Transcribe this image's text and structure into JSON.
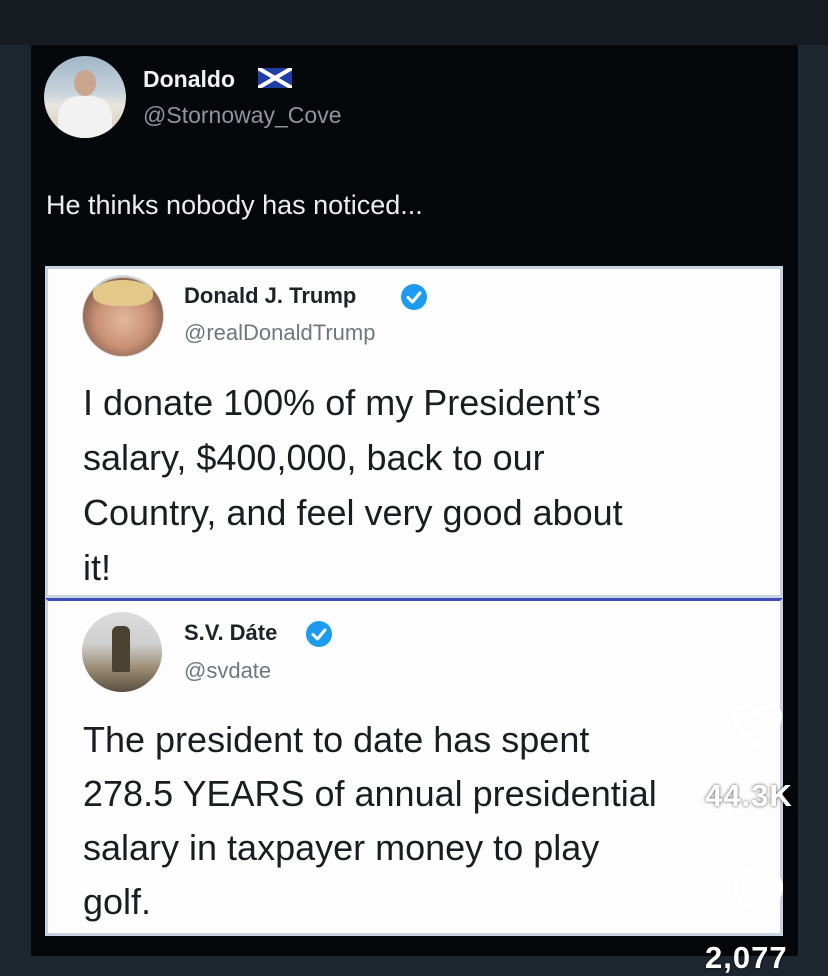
{
  "post": {
    "author_name": "Donaldo",
    "author_flag_icon": "scotland-flag-icon",
    "author_handle": "@Stornoway_Cove",
    "text": "He thinks nobody has noticed..."
  },
  "embedded_tweets": [
    {
      "name": "Donald J. Trump",
      "verified_icon": "verified-badge-icon",
      "handle": "@realDonaldTrump",
      "lines": [
        "I donate 100% of my President’s",
        "salary, $400,000, back to our",
        "Country, and feel very good about",
        "it!"
      ]
    },
    {
      "name": "S.V. Dáte",
      "verified_icon": "verified-badge-icon",
      "handle": "@svdate",
      "lines": [
        "The president to date has spent",
        "278.5 YEARS of annual presidential",
        "salary in taxpayer money to play",
        "golf."
      ]
    }
  ],
  "actions": {
    "like_icon": "heart-icon",
    "like_count": "44.3K",
    "comment_icon": "comment-icon",
    "comment_count": "2,077"
  },
  "colors": {
    "page_bg": "#1e262f",
    "post_bg": "#05070a",
    "card_bg": "#fdfdfd",
    "verified_blue": "#1d9bf0",
    "divider_blue": "#3d4dba"
  }
}
